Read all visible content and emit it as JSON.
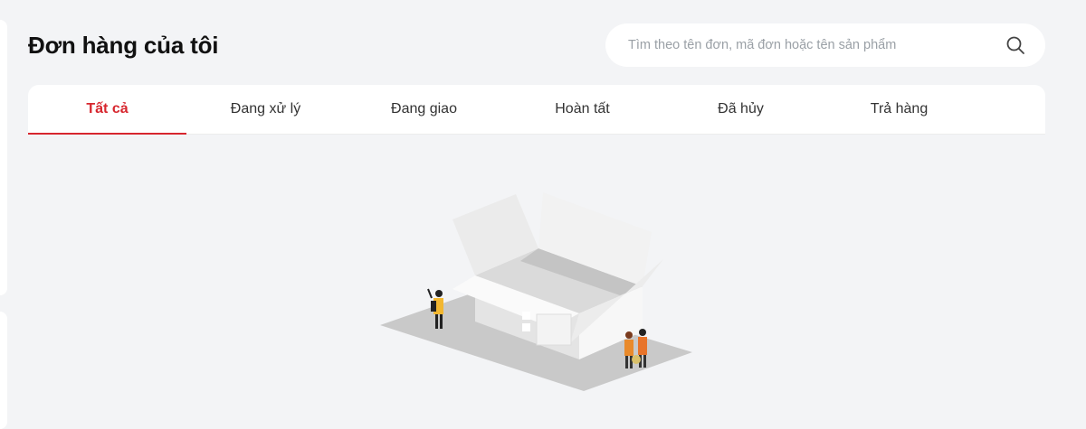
{
  "header": {
    "title": "Đơn hàng của tôi"
  },
  "search": {
    "placeholder": "Tìm theo tên đơn, mã đơn hoặc tên sản phẩm",
    "value": "",
    "icon": "search-icon"
  },
  "tabs": [
    {
      "label": "Tất cả",
      "active": true
    },
    {
      "label": "Đang xử lý",
      "active": false
    },
    {
      "label": "Đang giao",
      "active": false
    },
    {
      "label": "Hoàn tất",
      "active": false
    },
    {
      "label": "Đã hủy",
      "active": false
    },
    {
      "label": "Trả hàng",
      "active": false
    }
  ],
  "colors": {
    "accent": "#d7262e",
    "background": "#f3f4f6",
    "surface": "#ffffff",
    "text": "#111111"
  },
  "empty_state": {
    "illustration": "empty-box-illustration"
  }
}
